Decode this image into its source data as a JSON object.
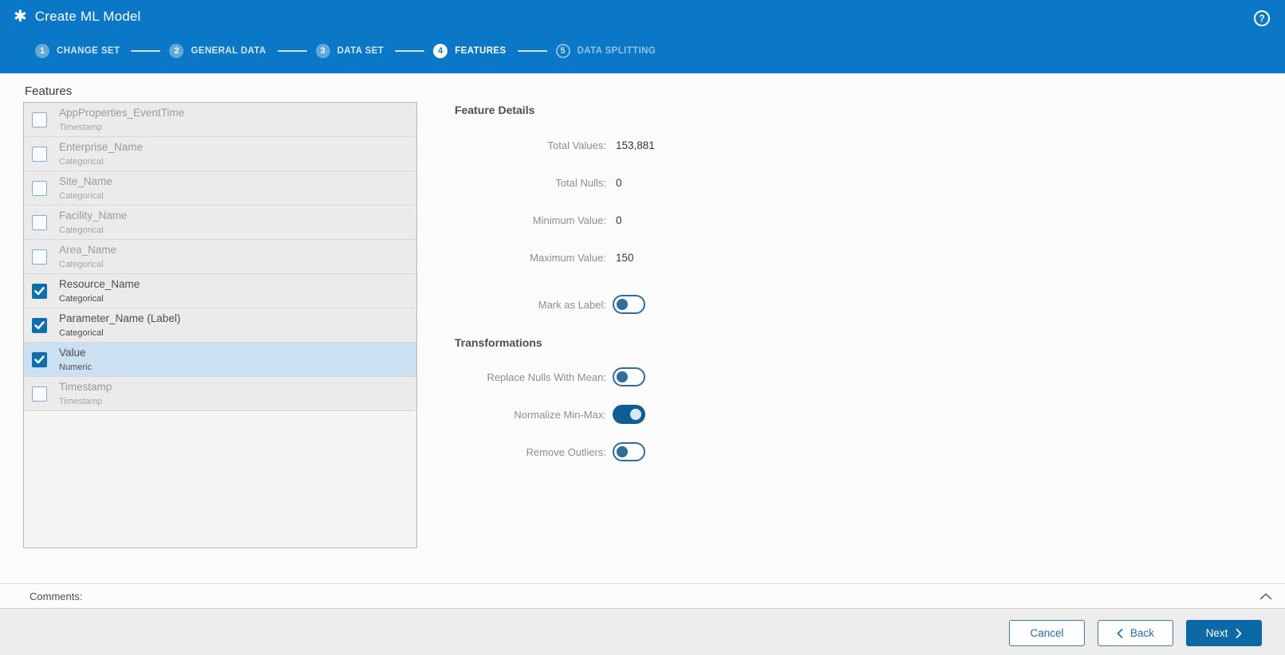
{
  "header": {
    "title": "Create ML Model",
    "icon_glyph": "✱",
    "help_glyph": "?"
  },
  "stepper": {
    "steps": [
      {
        "num": "1",
        "label": "CHANGE SET",
        "state": "done"
      },
      {
        "num": "2",
        "label": "GENERAL DATA",
        "state": "done"
      },
      {
        "num": "3",
        "label": "DATA SET",
        "state": "done"
      },
      {
        "num": "4",
        "label": "FEATURES",
        "state": "active"
      },
      {
        "num": "5",
        "label": "DATA SPLITTING",
        "state": "upcoming"
      }
    ]
  },
  "features_panel": {
    "heading": "Features",
    "items": [
      {
        "name": "AppProperties_EventTime",
        "type": "Timestamp",
        "checked": false,
        "selected": false
      },
      {
        "name": "Enterprise_Name",
        "type": "Categorical",
        "checked": false,
        "selected": false
      },
      {
        "name": "Site_Name",
        "type": "Categorical",
        "checked": false,
        "selected": false
      },
      {
        "name": "Facility_Name",
        "type": "Categorical",
        "checked": false,
        "selected": false
      },
      {
        "name": "Area_Name",
        "type": "Categorical",
        "checked": false,
        "selected": false
      },
      {
        "name": "Resource_Name",
        "type": "Categorical",
        "checked": true,
        "selected": false
      },
      {
        "name": "Parameter_Name (Label)",
        "type": "Categorical",
        "checked": true,
        "selected": false
      },
      {
        "name": "Value",
        "type": "Numeric",
        "checked": true,
        "selected": true
      },
      {
        "name": "Timestamp",
        "type": "Timestamp",
        "checked": false,
        "selected": false
      }
    ]
  },
  "details_panel": {
    "heading": "Feature Details",
    "stats": [
      {
        "label": "Total Values:",
        "value": "153,881"
      },
      {
        "label": "Total Nulls:",
        "value": "0"
      },
      {
        "label": "Minimum Value:",
        "value": "0"
      },
      {
        "label": "Maximum Value:",
        "value": "150"
      }
    ],
    "mark_as_label": {
      "label": "Mark as Label:",
      "on": false
    },
    "transformations": {
      "heading": "Transformations",
      "toggles": [
        {
          "label": "Replace Nulls With Mean:",
          "on": false
        },
        {
          "label": "Normalize Min-Max:",
          "on": true
        },
        {
          "label": "Remove Outliers:",
          "on": false
        }
      ]
    }
  },
  "comments": {
    "label": "Comments:"
  },
  "footer": {
    "cancel_label": "Cancel",
    "back_label": "Back",
    "next_label": "Next"
  },
  "colors": {
    "header_bg": "#0a78c6",
    "primary_button": "#0d68a6",
    "toggle_on": "#0e5e95",
    "checkbox_checked": "#0d6eb0",
    "selected_row_bg": "#cbe0f1"
  }
}
